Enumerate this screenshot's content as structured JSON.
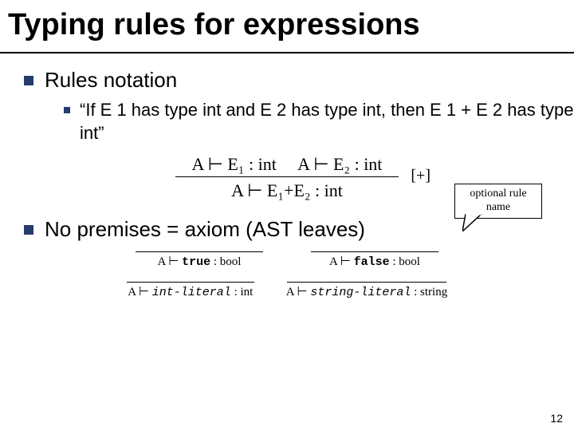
{
  "title": "Typing rules for expressions",
  "bullets": {
    "b1": "Rules notation",
    "b1a": "“If E 1 has type int and E 2 has type int, then E 1 + E 2 has type int”",
    "b2": "No premises = axiom (AST leaves)"
  },
  "callout": "optional rule name",
  "rule": {
    "premise1": "A ⊢ E₁ : int",
    "premise2": "A ⊢ E₂ : int",
    "label": "[+]",
    "conclusion": "A ⊢ E₁+E₂ : int"
  },
  "axioms": {
    "a1_pre": "A ⊢ ",
    "a1_kw": "true",
    "a1_post": " : bool",
    "a2_pre": "A ⊢ ",
    "a2_kw": "false",
    "a2_post": " : bool",
    "a3_pre": "A ⊢ ",
    "a3_it": "int-literal",
    "a3_post": " : int",
    "a4_pre": "A ⊢ ",
    "a4_it": "string-literal",
    "a4_post": " : string"
  },
  "pagenum": "12"
}
